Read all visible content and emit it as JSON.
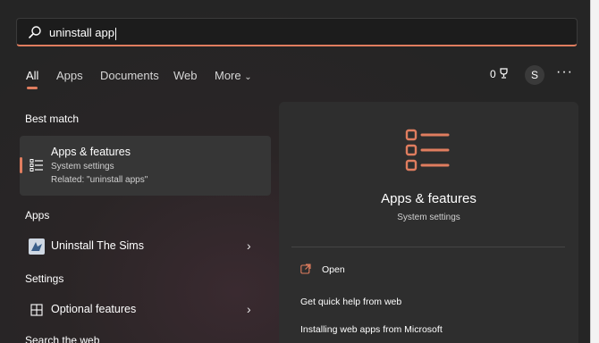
{
  "search": {
    "value": "uninstall app"
  },
  "tabs": [
    "All",
    "Apps",
    "Documents",
    "Web",
    "More"
  ],
  "header": {
    "points": "0",
    "avatar_letter": "S",
    "more_icon": "ellipsis-icon"
  },
  "sections": {
    "best_match": "Best match",
    "apps": "Apps",
    "settings": "Settings",
    "search_web": "Search the web"
  },
  "best_match": {
    "title": "Apps & features",
    "subtitle": "System settings",
    "related": "Related: \"uninstall apps\"",
    "icon": "list-icon"
  },
  "apps": [
    {
      "label": "Uninstall The Sims",
      "icon": "sims-app-icon"
    }
  ],
  "settings": [
    {
      "label": "Optional features",
      "icon": "optional-features-icon"
    }
  ],
  "preview": {
    "title": "Apps & features",
    "subtitle": "System settings",
    "actions": [
      "Open",
      "Get quick help from web",
      "Installing web apps from Microsoft"
    ]
  },
  "colors": {
    "accent": "#e07d5f",
    "background": "#252525",
    "card": "#363636"
  }
}
